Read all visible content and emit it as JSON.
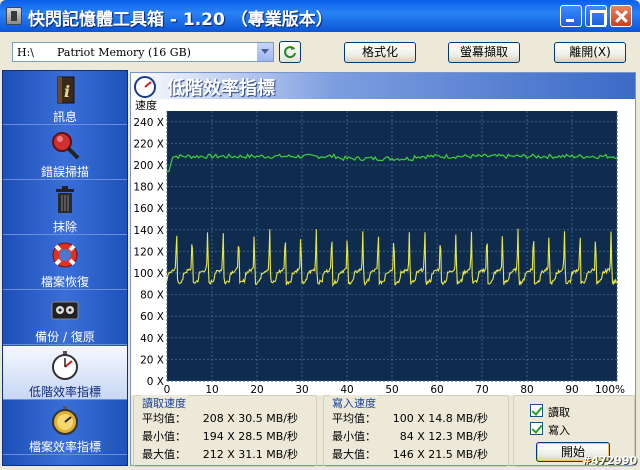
{
  "window": {
    "title": "快閃記憶體工具箱 - 1.20 （專業版本）"
  },
  "toolbar": {
    "drive_letter": "H:\\",
    "drive_name": "Patriot Memory (16 GB)",
    "format_label": "格式化",
    "capture_label": "螢幕擷取",
    "exit_label": "離開(X)"
  },
  "sidebar": {
    "items": [
      {
        "label": "訊息",
        "icon": "info-icon"
      },
      {
        "label": "錯誤掃描",
        "icon": "magnifier-icon"
      },
      {
        "label": "抹除",
        "icon": "trash-icon"
      },
      {
        "label": "檔案恢復",
        "icon": "lifebuoy-icon"
      },
      {
        "label": "備份 / 復原",
        "icon": "tape-icon"
      },
      {
        "label": "低階效率指標",
        "icon": "stopwatch-icon",
        "active": true
      },
      {
        "label": "檔案效率指標",
        "icon": "stopwatch-gold-icon"
      }
    ]
  },
  "panel": {
    "title": "低階效率指標"
  },
  "chart_data": {
    "type": "line",
    "ylabel": "速度",
    "y_ticks": [
      "0 X",
      "20 X",
      "40 X",
      "60 X",
      "80 X",
      "100 X",
      "120 X",
      "140 X",
      "160 X",
      "180 X",
      "200 X",
      "220 X",
      "240 X"
    ],
    "x_ticks": [
      "0",
      "10",
      "20",
      "30",
      "40",
      "50",
      "60",
      "70",
      "80",
      "90",
      "100%"
    ],
    "xlim": [
      0,
      100
    ],
    "ylim": [
      0,
      250
    ],
    "grid": true,
    "background": "#0f2b4e",
    "series": [
      {
        "key": "read",
        "color": "#3ad23a",
        "base": 208,
        "min": 194,
        "max": 212
      },
      {
        "key": "write",
        "color": "#e8e840",
        "base": 100,
        "min": 84,
        "max": 146,
        "spikes": 29
      }
    ]
  },
  "stats": {
    "read": {
      "title": "讀取速度",
      "rows": [
        {
          "label": "平均值：",
          "value": "208 X  30.5 MB/秒"
        },
        {
          "label": "最小值：",
          "value": "194 X  28.5 MB/秒"
        },
        {
          "label": "最大值：",
          "value": "212 X  31.1 MB/秒"
        }
      ]
    },
    "write": {
      "title": "寫入速度",
      "rows": [
        {
          "label": "平均值：",
          "value": "100 X 14.8 MB/秒"
        },
        {
          "label": "最小值：",
          "value": "84 X 12.3 MB/秒"
        },
        {
          "label": "最大值：",
          "value": "146 X 21.5 MB/秒"
        }
      ]
    }
  },
  "options": {
    "read_label": "讀取",
    "write_label": "寫入",
    "start_label": "開始"
  },
  "watermark": "#472990"
}
